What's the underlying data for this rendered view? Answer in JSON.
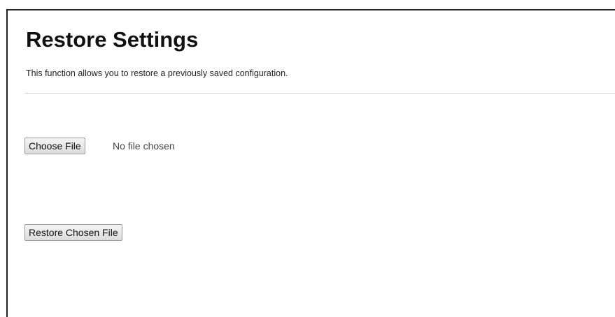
{
  "page": {
    "title": "Restore Settings",
    "description": "This function allows you to restore a previously saved configuration."
  },
  "file_input": {
    "button_label": "Choose File",
    "status_text": "No file chosen"
  },
  "actions": {
    "restore_label": "Restore Chosen File"
  }
}
